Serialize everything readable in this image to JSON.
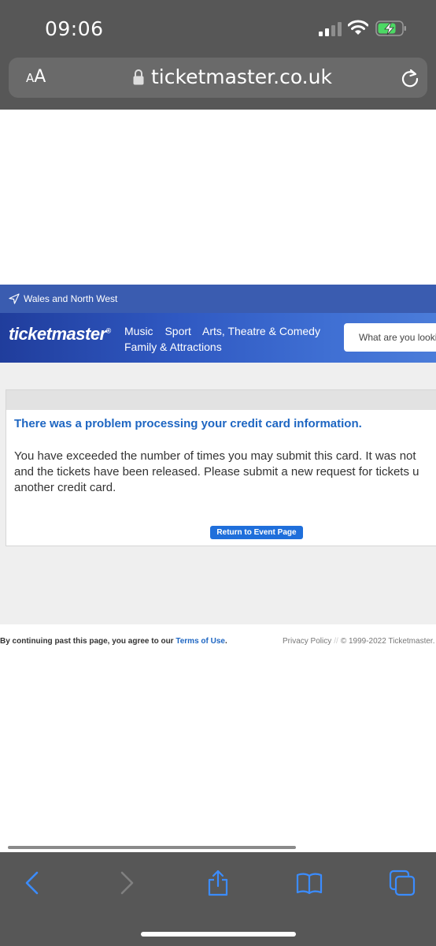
{
  "status_bar": {
    "time": "09:06"
  },
  "browser": {
    "aa_label_small": "A",
    "aa_label_big": "A",
    "url": "ticketmaster.co.uk"
  },
  "site": {
    "location": "Wales and North West",
    "logo": "ticketmaster",
    "logo_mark": "®",
    "nav_row1": [
      "Music",
      "Sport",
      "Arts, Theatre & Comedy"
    ],
    "nav_row2": [
      "Family & Attractions"
    ],
    "search_placeholder": "What are you looking for?"
  },
  "error": {
    "heading": "There was a problem processing your credit card information.",
    "body_lines": [
      "You have exceeded the number of times you may submit this card. It was not",
      "and the tickets have been released. Please submit a new request for tickets u",
      "another credit card."
    ],
    "button": "Return to Event Page"
  },
  "footer": {
    "agree_text": "By continuing past this page, you agree to our ",
    "terms_link": "Terms of Use",
    "agree_end": ".",
    "privacy": "Privacy Policy",
    "separator": "//",
    "copyright": "© 1999-2022 Ticketmaster."
  },
  "colors": {
    "chrome": "#575757",
    "brand_blue": "#2f58c1",
    "link_blue": "#1e66c2",
    "button_blue": "#1f6fdb"
  }
}
